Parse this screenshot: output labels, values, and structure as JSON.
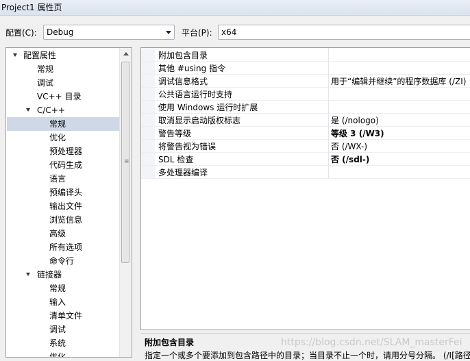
{
  "window": {
    "title": "Project1 属性页"
  },
  "config": {
    "config_label": "配置(C):",
    "config_value": "Debug",
    "platform_label": "平台(P):",
    "platform_value": "x64"
  },
  "tree": [
    {
      "label": "配置属性",
      "level": 0,
      "expanded": true,
      "selected": false
    },
    {
      "label": "常规",
      "level": 1,
      "selected": false
    },
    {
      "label": "调试",
      "level": 1,
      "selected": false
    },
    {
      "label": "VC++ 目录",
      "level": 1,
      "selected": false
    },
    {
      "label": "C/C++",
      "level": 1,
      "expanded": true,
      "selected": false
    },
    {
      "label": "常规",
      "level": 2,
      "selected": true
    },
    {
      "label": "优化",
      "level": 2,
      "selected": false
    },
    {
      "label": "预处理器",
      "level": 2,
      "selected": false
    },
    {
      "label": "代码生成",
      "level": 2,
      "selected": false
    },
    {
      "label": "语言",
      "level": 2,
      "selected": false
    },
    {
      "label": "预编译头",
      "level": 2,
      "selected": false
    },
    {
      "label": "输出文件",
      "level": 2,
      "selected": false
    },
    {
      "label": "浏览信息",
      "level": 2,
      "selected": false
    },
    {
      "label": "高级",
      "level": 2,
      "selected": false
    },
    {
      "label": "所有选项",
      "level": 2,
      "selected": false
    },
    {
      "label": "命令行",
      "level": 2,
      "selected": false
    },
    {
      "label": "链接器",
      "level": 1,
      "expanded": true,
      "selected": false
    },
    {
      "label": "常规",
      "level": 2,
      "selected": false
    },
    {
      "label": "输入",
      "level": 2,
      "selected": false
    },
    {
      "label": "清单文件",
      "level": 2,
      "selected": false
    },
    {
      "label": "调试",
      "level": 2,
      "selected": false
    },
    {
      "label": "系统",
      "level": 2,
      "selected": false
    },
    {
      "label": "优化",
      "level": 2,
      "selected": false
    }
  ],
  "properties": [
    {
      "name": "附加包含目录",
      "value": "",
      "bold": false
    },
    {
      "name": "其他 #using 指令",
      "value": "",
      "bold": false
    },
    {
      "name": "调试信息格式",
      "value": "用于“编辑并继续”的程序数据库 (/ZI)",
      "bold": false
    },
    {
      "name": "公共语言运行时支持",
      "value": "",
      "bold": false
    },
    {
      "name": "使用 Windows 运行时扩展",
      "value": "",
      "bold": false
    },
    {
      "name": "取消显示启动版权标志",
      "value": "是 (/nologo)",
      "bold": false
    },
    {
      "name": "警告等级",
      "value": "等级 3 (/W3)",
      "bold": true
    },
    {
      "name": "将警告视为错误",
      "value": "否 (/WX-)",
      "bold": false
    },
    {
      "name": "SDL 检查",
      "value": "否 (/sdl-)",
      "bold": true
    },
    {
      "name": "多处理器编译",
      "value": "",
      "bold": false
    }
  ],
  "description": {
    "title": "附加包含目录",
    "text": "指定一个或多个要添加到包含路径中的目录；当目录不止一个时，请用分号分隔。     (/I[路径])"
  },
  "watermark": "https://blog.csdn.net/SLAM_masterFei"
}
